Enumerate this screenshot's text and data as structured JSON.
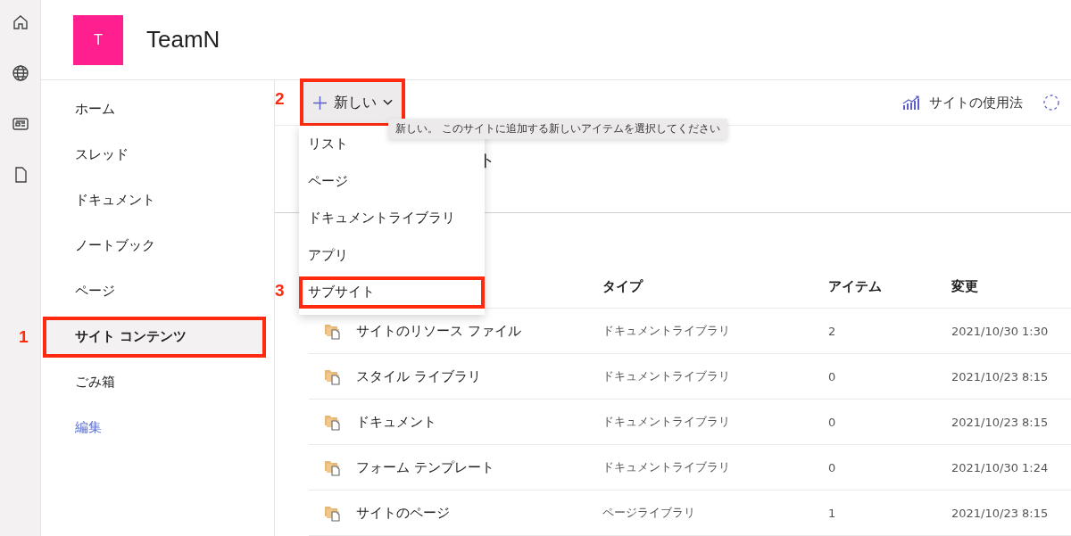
{
  "site": {
    "logo_letter": "T",
    "title": "TeamN"
  },
  "rail": [
    {
      "kind": "home"
    },
    {
      "kind": "globe"
    },
    {
      "kind": "news"
    },
    {
      "kind": "file"
    }
  ],
  "nav": [
    {
      "label": "ホーム",
      "selected": false,
      "kind": "item",
      "highlighted": false
    },
    {
      "label": "スレッド",
      "selected": false,
      "kind": "item",
      "highlighted": false
    },
    {
      "label": "ドキュメント",
      "selected": false,
      "kind": "item",
      "highlighted": false
    },
    {
      "label": "ノートブック",
      "selected": false,
      "kind": "item",
      "highlighted": false
    },
    {
      "label": "ページ",
      "selected": false,
      "kind": "item",
      "highlighted": false
    },
    {
      "label": "サイト コンテンツ",
      "selected": true,
      "kind": "item",
      "highlighted": true,
      "step": "1"
    },
    {
      "label": "ごみ箱",
      "selected": false,
      "kind": "item",
      "highlighted": false
    },
    {
      "label": "編集",
      "selected": false,
      "kind": "link",
      "highlighted": false
    }
  ],
  "command_bar": {
    "new_button": {
      "label": "新しい",
      "highlighted": true,
      "step": "2"
    },
    "usage": "サイトの使用法"
  },
  "tooltip": "新しい。 このサイトに追加する新しいアイテムを選択してください",
  "menu": [
    {
      "label": "リスト",
      "highlighted": false
    },
    {
      "label": "ページ",
      "highlighted": false
    },
    {
      "label": "ドキュメントライブラリ",
      "highlighted": false
    },
    {
      "label": "アプリ",
      "highlighted": false
    },
    {
      "label": "サブサイト",
      "highlighted": true,
      "step": "3"
    }
  ],
  "heading_fragment": "ト",
  "table": {
    "columns": [
      "タイプ",
      "アイテム",
      "変更"
    ],
    "rows": [
      {
        "name": "サイトのリソース ファイル",
        "type": "ドキュメントライブラリ",
        "items": "2",
        "modified": "2021/10/30 1:30"
      },
      {
        "name": "スタイル ライブラリ",
        "type": "ドキュメントライブラリ",
        "items": "0",
        "modified": "2021/10/23 8:15"
      },
      {
        "name": "ドキュメント",
        "type": "ドキュメントライブラリ",
        "items": "0",
        "modified": "2021/10/23 8:15"
      },
      {
        "name": "フォーム テンプレート",
        "type": "ドキュメントライブラリ",
        "items": "0",
        "modified": "2021/10/30 1:24"
      },
      {
        "name": "サイトのページ",
        "type": "ページライブラリ",
        "items": "1",
        "modified": "2021/10/23 8:15"
      }
    ]
  }
}
